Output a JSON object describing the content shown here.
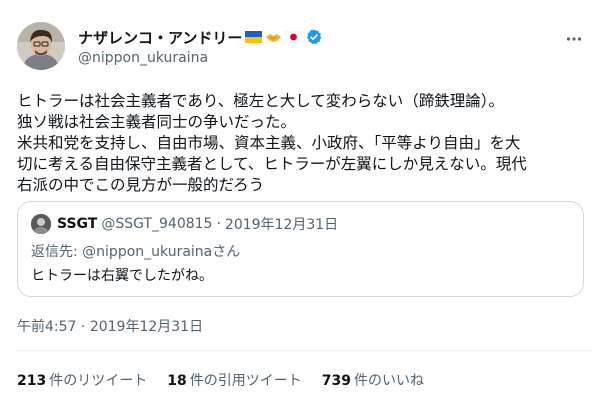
{
  "author": {
    "display_name": "ナザレンコ・アンドリー",
    "handle": "@nippon_ukuraina",
    "emoji_icons": [
      "ukraine-flag-icon",
      "handshake-icon",
      "japan-flag-icon"
    ],
    "verified_color": "#1d9bf0"
  },
  "tweet": {
    "lines": [
      "ヒトラーは社会主義者であり、極左と大して変わらない（蹄鉄理論）。",
      "独ソ戦は社会主義者同士の争いだった。",
      "米共和党を支持し、自由市場、資本主義、小政府、「平等より自由」を大",
      "切に考える自由保守主義者として、ヒトラーが左翼にしか見えない。現代",
      "右派の中でこの見方が一般的だろう"
    ]
  },
  "quote": {
    "display_name": "SSGT",
    "handle": "@SSGT_940815",
    "separator": "·",
    "date": "2019年12月31日",
    "reply_prefix": "返信先: ",
    "reply_mention": "@nippon_ukurainaさん",
    "body": "ヒトラーは右翼でしたがね。"
  },
  "timestamp": {
    "time": "午前4:57",
    "separator": " · ",
    "date": "2019年12月31日"
  },
  "stats": [
    {
      "count": "213",
      "label": "件のリツイート"
    },
    {
      "count": "18",
      "label": "件の引用ツイート"
    },
    {
      "count": "739",
      "label": "件のいいね"
    }
  ],
  "colors": {
    "text": "#0f1419",
    "secondary": "#536471",
    "border": "#cfd9de",
    "accent": "#1d9bf0"
  }
}
